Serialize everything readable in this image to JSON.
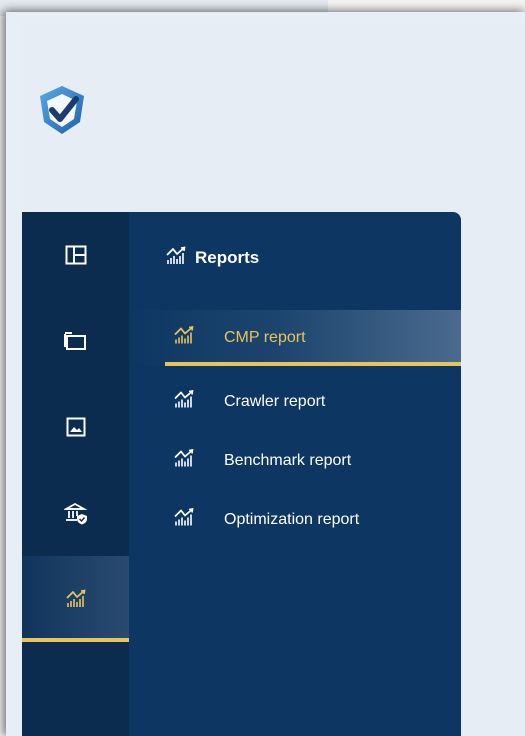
{
  "app": {
    "logo_icon": "shield-check-logo-icon"
  },
  "rail": {
    "items": [
      {
        "icon": "dashboard-icon",
        "active": false
      },
      {
        "icon": "folder-icon",
        "active": false
      },
      {
        "icon": "image-icon",
        "active": false
      },
      {
        "icon": "institution-shield-icon",
        "active": false
      },
      {
        "icon": "reports-chart-icon",
        "active": true
      }
    ]
  },
  "panel": {
    "title": "Reports",
    "title_icon": "reports-chart-icon",
    "items": [
      {
        "label": "CMP report",
        "icon": "reports-chart-icon",
        "active": true
      },
      {
        "label": "Crawler report",
        "icon": "reports-chart-icon",
        "active": false
      },
      {
        "label": "Benchmark report",
        "icon": "reports-chart-icon",
        "active": false
      },
      {
        "label": "Optimization report",
        "icon": "reports-chart-icon",
        "active": false
      }
    ]
  },
  "colors": {
    "rail_bg": "#0b2b4f",
    "panel_bg": "#0d3762",
    "accent": "#e7c55a",
    "app_bg": "#e6edf5"
  }
}
